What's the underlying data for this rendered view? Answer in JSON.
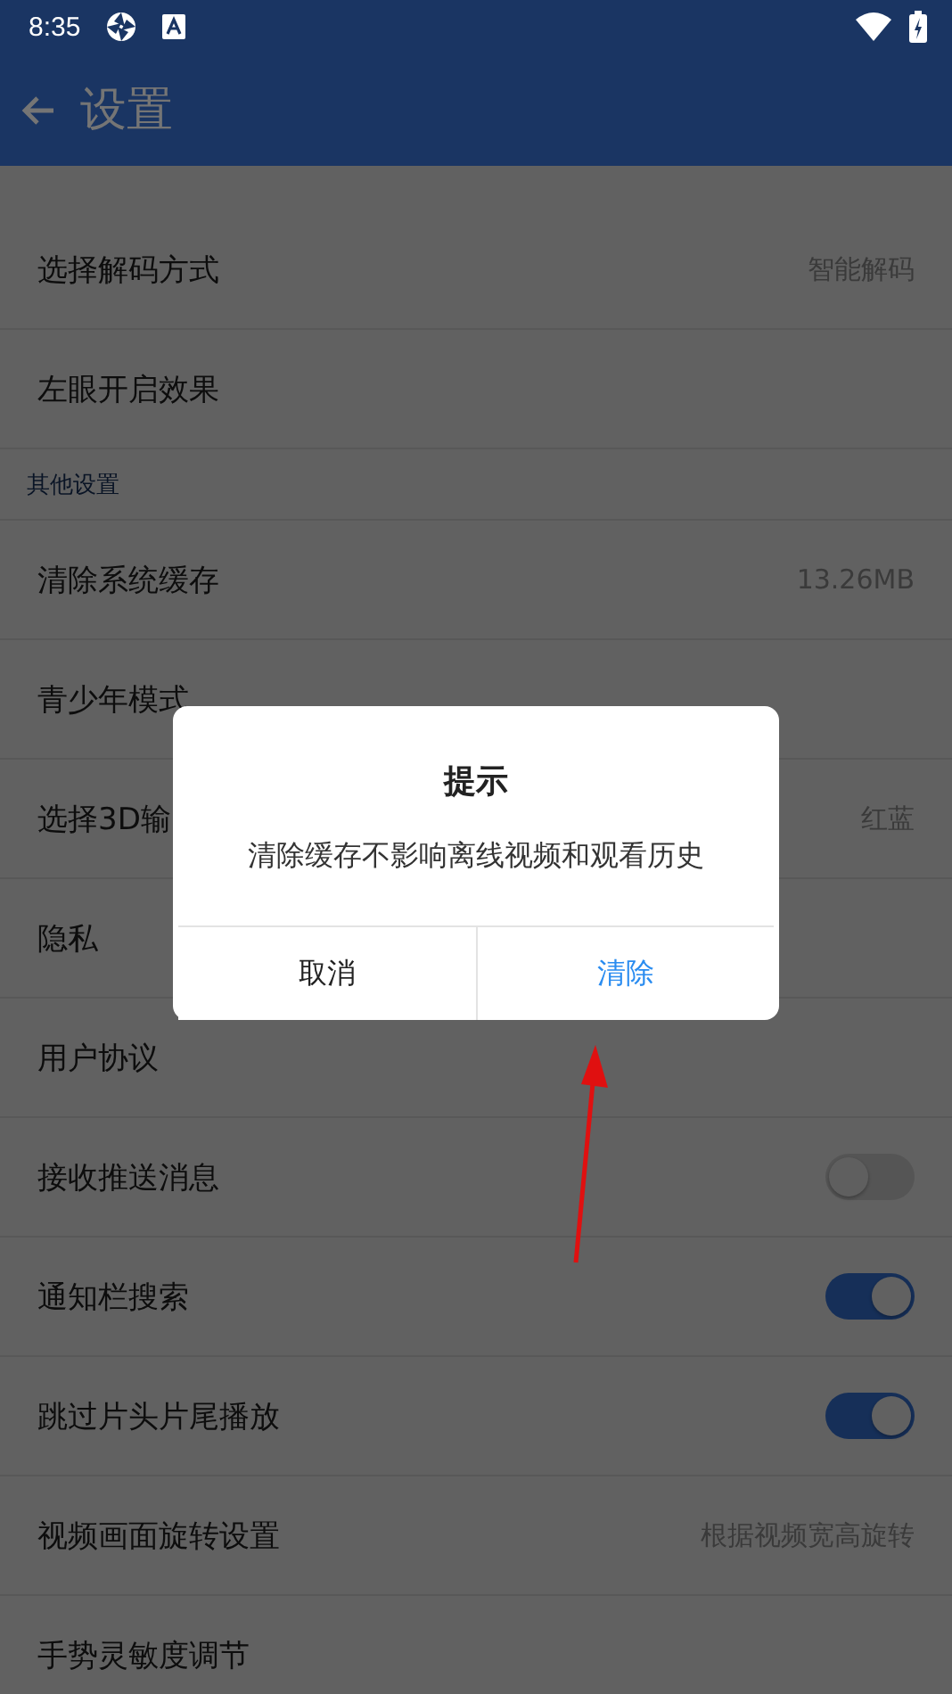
{
  "status_bar": {
    "time": "8:35"
  },
  "toolbar": {
    "title": "设置"
  },
  "settings": [
    {
      "kind": "value",
      "label": "选择解码方式",
      "value": "智能解码"
    },
    {
      "kind": "plain",
      "label": "左眼开启效果"
    },
    {
      "kind": "header",
      "label": "其他设置"
    },
    {
      "kind": "value",
      "label": "清除系统缓存",
      "value": "13.26MB"
    },
    {
      "kind": "plain",
      "label": "青少年模式"
    },
    {
      "kind": "value",
      "label": "选择3D输",
      "value": "红蓝"
    },
    {
      "kind": "plain",
      "label": "隐私"
    },
    {
      "kind": "plain",
      "label": "用户协议"
    },
    {
      "kind": "toggle",
      "label": "接收推送消息",
      "on": false
    },
    {
      "kind": "toggle",
      "label": "通知栏搜索",
      "on": true
    },
    {
      "kind": "toggle",
      "label": "跳过片头片尾播放",
      "on": true
    },
    {
      "kind": "value",
      "label": "视频画面旋转设置",
      "value": "根据视频宽高旋转"
    },
    {
      "kind": "plain",
      "label": "手势灵敏度调节"
    }
  ],
  "dialog": {
    "title": "提示",
    "message": "清除缓存不影响离线视频和观看历史",
    "buttons": [
      {
        "label": "取消",
        "kind": "neutral"
      },
      {
        "label": "清除",
        "kind": "primary"
      }
    ]
  }
}
